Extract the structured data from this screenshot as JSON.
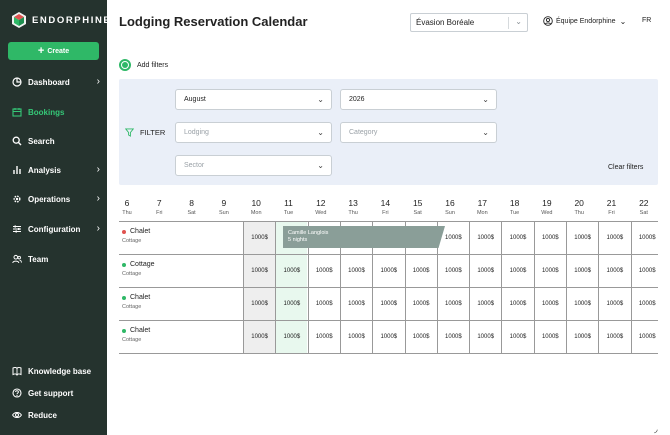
{
  "brand": {
    "name": "ENDORPHINE"
  },
  "sidebar": {
    "create_label": "Create",
    "items": [
      {
        "label": "Dashboard",
        "icon": "pie-chart-icon",
        "has_submenu": true
      },
      {
        "label": "Bookings",
        "icon": "calendar-icon",
        "active": true
      },
      {
        "label": "Search",
        "icon": "search-icon"
      },
      {
        "label": "Analysis",
        "icon": "bar-chart-icon",
        "has_submenu": true
      },
      {
        "label": "Operations",
        "icon": "gear-icon",
        "has_submenu": true
      },
      {
        "label": "Configuration",
        "icon": "sliders-icon",
        "has_submenu": true
      },
      {
        "label": "Team",
        "icon": "users-icon"
      }
    ],
    "footer": [
      {
        "label": "Knowledge base",
        "icon": "book-icon"
      },
      {
        "label": "Get support",
        "icon": "help-icon"
      },
      {
        "label": "Reduce",
        "icon": "eye-icon"
      }
    ]
  },
  "header": {
    "title": "Lodging Reservation Calendar",
    "company": "Évasion Boréale",
    "account": "Équipe Endorphine",
    "lang": "FR"
  },
  "filters": {
    "add_label": "Add filters",
    "label": "FILTER",
    "month": "August",
    "year": "2026",
    "lodging_placeholder": "Lodging",
    "category_placeholder": "Category",
    "sector_placeholder": "Sector",
    "clear_label": "Clear filters"
  },
  "calendar": {
    "days": [
      {
        "num": "6",
        "dow": "Thu"
      },
      {
        "num": "7",
        "dow": "Fri"
      },
      {
        "num": "8",
        "dow": "Sat"
      },
      {
        "num": "9",
        "dow": "Sun"
      },
      {
        "num": "10",
        "dow": "Mon"
      },
      {
        "num": "11",
        "dow": "Tue"
      },
      {
        "num": "12",
        "dow": "Wed"
      },
      {
        "num": "13",
        "dow": "Thu"
      },
      {
        "num": "14",
        "dow": "Fri"
      },
      {
        "num": "15",
        "dow": "Sat"
      },
      {
        "num": "16",
        "dow": "Sun"
      },
      {
        "num": "17",
        "dow": "Mon"
      },
      {
        "num": "18",
        "dow": "Tue"
      },
      {
        "num": "19",
        "dow": "Wed"
      },
      {
        "num": "20",
        "dow": "Thu"
      },
      {
        "num": "21",
        "dow": "Fri"
      },
      {
        "num": "22",
        "dow": "Sat"
      }
    ],
    "price": "1000$",
    "rows": [
      {
        "name": "Chalet",
        "type": "Cottage",
        "status_color": "#e0524f"
      },
      {
        "name": "Cottage",
        "type": "Cottage",
        "status_color": "#2fb867"
      },
      {
        "name": "Chalet",
        "type": "Cottage",
        "status_color": "#2fb867"
      },
      {
        "name": "Chalet",
        "type": "Cottage",
        "status_color": "#2fb867"
      }
    ],
    "booking": {
      "guest": "Camille Langlois",
      "nights": "5 nights"
    }
  },
  "colors": {
    "sidebar_bg": "#25332e",
    "accent": "#2fb867",
    "filter_bg": "#eaeff8",
    "booking_bg": "#8a9e98"
  }
}
